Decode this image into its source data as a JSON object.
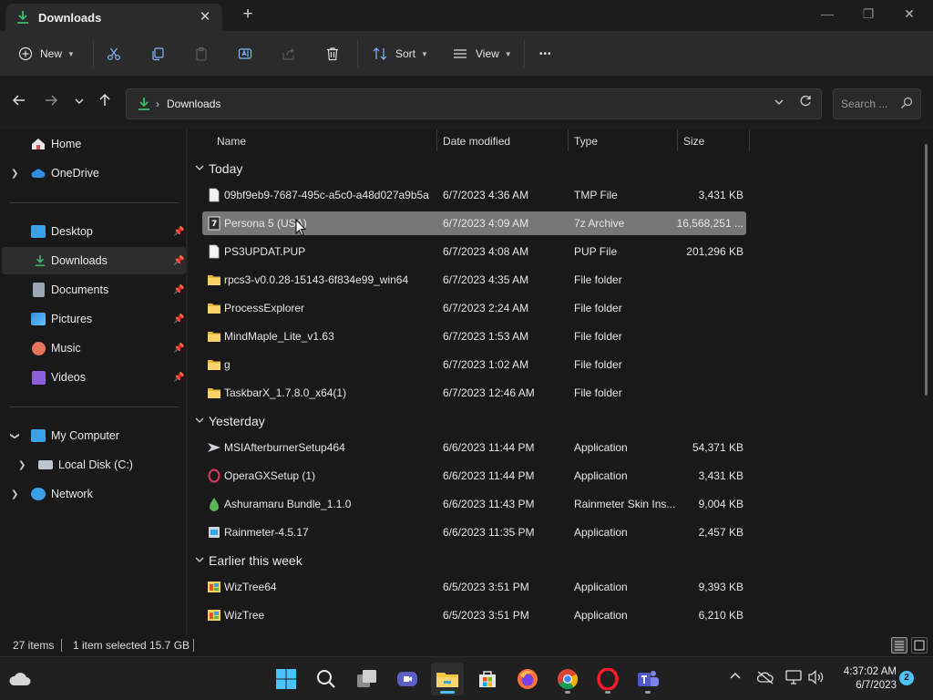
{
  "window": {
    "tab_title": "Downloads",
    "tab_close_glyph": "✕",
    "new_tab_glyph": "+",
    "minimize_glyph": "—",
    "restore_glyph": "❐",
    "close_glyph": "✕"
  },
  "toolbar": {
    "new_label": "New",
    "sort_label": "Sort",
    "view_label": "View",
    "more_glyph": "•••",
    "icons": [
      "cut-icon",
      "copy-icon",
      "paste-icon",
      "rename-icon",
      "share-icon",
      "delete-icon"
    ]
  },
  "address": {
    "crumbs": [
      "Downloads"
    ],
    "separator_glyph": "›",
    "search_placeholder": "Search ..."
  },
  "nav": {
    "quick": [
      {
        "label": "Home",
        "icon": "home-icon"
      },
      {
        "label": "OneDrive",
        "icon": "onedrive-icon"
      }
    ],
    "pinned": [
      {
        "label": "Desktop",
        "icon": "desktop-icon",
        "pinned": true
      },
      {
        "label": "Downloads",
        "icon": "downloads-icon",
        "pinned": true,
        "selected": true
      },
      {
        "label": "Documents",
        "icon": "documents-icon",
        "pinned": true
      },
      {
        "label": "Pictures",
        "icon": "pictures-icon",
        "pinned": true
      },
      {
        "label": "Music",
        "icon": "music-icon",
        "pinned": true
      },
      {
        "label": "Videos",
        "icon": "videos-icon",
        "pinned": true
      }
    ],
    "tree": [
      {
        "label": "My Computer",
        "icon": "computer-icon",
        "expanded": true
      },
      {
        "label": "Local Disk (C:)",
        "icon": "disk-icon"
      },
      {
        "label": "Network",
        "icon": "network-icon"
      }
    ],
    "pin_glyph": "📌"
  },
  "columns": {
    "name": "Name",
    "date": "Date modified",
    "type": "Type",
    "size": "Size"
  },
  "groups": [
    {
      "label": "Today",
      "files": [
        {
          "name": "09bf9eb9-7687-495c-a5c0-a48d027a9b5a....",
          "date": "6/7/2023 4:36 AM",
          "type": "TMP File",
          "size": "3,431 KB",
          "icon": "file-icon"
        },
        {
          "name": "Persona 5 (USA)",
          "date": "6/7/2023 4:09 AM",
          "type": "7z Archive",
          "size": "16,568,251 ...",
          "icon": "archive-icon",
          "selected": true
        },
        {
          "name": "PS3UPDAT.PUP",
          "date": "6/7/2023 4:08 AM",
          "type": "PUP File",
          "size": "201,296 KB",
          "icon": "file-icon"
        },
        {
          "name": "rpcs3-v0.0.28-15143-6f834e99_win64",
          "date": "6/7/2023 4:35 AM",
          "type": "File folder",
          "size": "",
          "icon": "folder-icon"
        },
        {
          "name": "ProcessExplorer",
          "date": "6/7/2023 2:24 AM",
          "type": "File folder",
          "size": "",
          "icon": "folder-icon"
        },
        {
          "name": "MindMaple_Lite_v1.63",
          "date": "6/7/2023 1:53 AM",
          "type": "File folder",
          "size": "",
          "icon": "folder-icon"
        },
        {
          "name": "g",
          "date": "6/7/2023 1:02 AM",
          "type": "File folder",
          "size": "",
          "icon": "folder-icon"
        },
        {
          "name": "TaskbarX_1.7.8.0_x64(1)",
          "date": "6/7/2023 12:46 AM",
          "type": "File folder",
          "size": "",
          "icon": "folder-icon"
        }
      ]
    },
    {
      "label": "Yesterday",
      "files": [
        {
          "name": "MSIAfterburnerSetup464",
          "date": "6/6/2023 11:44 PM",
          "type": "Application",
          "size": "54,371 KB",
          "icon": "afterburner-icon"
        },
        {
          "name": "OperaGXSetup (1)",
          "date": "6/6/2023 11:44 PM",
          "type": "Application",
          "size": "3,431 KB",
          "icon": "operagx-icon"
        },
        {
          "name": "Ashuramaru Bundle_1.1.0",
          "date": "6/6/2023 11:43 PM",
          "type": "Rainmeter Skin Ins...",
          "size": "9,004 KB",
          "icon": "rainmeter-skin-icon"
        },
        {
          "name": "Rainmeter-4.5.17",
          "date": "6/6/2023 11:35 PM",
          "type": "Application",
          "size": "2,457 KB",
          "icon": "installer-icon"
        }
      ]
    },
    {
      "label": "Earlier this week",
      "files": [
        {
          "name": "WizTree64",
          "date": "6/5/2023 3:51 PM",
          "type": "Application",
          "size": "9,393 KB",
          "icon": "wiztree-icon"
        },
        {
          "name": "WizTree",
          "date": "6/5/2023 3:51 PM",
          "type": "Application",
          "size": "6,210 KB",
          "icon": "wiztree-icon"
        }
      ]
    }
  ],
  "status": {
    "item_count": "27 items",
    "selection": "1 item selected",
    "selection_size": "15.7 GB"
  },
  "taskbar": {
    "apps": [
      "start-icon",
      "search-icon",
      "task-view-icon",
      "meet-icon",
      "file-explorer-icon",
      "store-icon",
      "firefox-icon",
      "chrome-icon",
      "opera-icon",
      "teams-icon"
    ],
    "active_app": "file-explorer-icon",
    "time": "4:37:02 AM",
    "date": "6/7/2023",
    "notification_count": "2"
  },
  "colors": {
    "accent": "#4cc2ff",
    "folder": "#f4c542",
    "selected_row": "#777777"
  }
}
